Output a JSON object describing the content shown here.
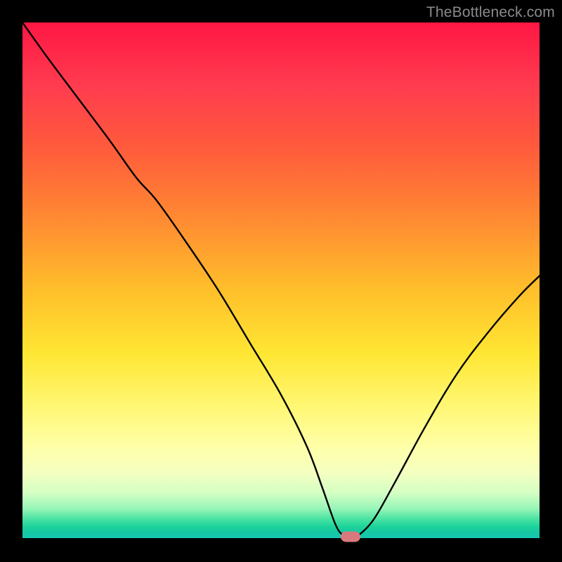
{
  "watermark": "TheBottleneck.com",
  "chart_data": {
    "type": "line",
    "title": "",
    "xlabel": "",
    "ylabel": "",
    "xlim": [
      0,
      100
    ],
    "ylim": [
      0,
      100
    ],
    "gradient_zones": [
      {
        "color": "#ff1744",
        "pct": 0
      },
      {
        "color": "#ff3b4f",
        "pct": 12
      },
      {
        "color": "#ff5a3c",
        "pct": 24
      },
      {
        "color": "#ff8a32",
        "pct": 38
      },
      {
        "color": "#ffc02b",
        "pct": 52
      },
      {
        "color": "#ffe633",
        "pct": 64
      },
      {
        "color": "#fff772",
        "pct": 74
      },
      {
        "color": "#ffffa8",
        "pct": 82
      },
      {
        "color": "#f5ffc0",
        "pct": 87
      },
      {
        "color": "#d4ffc4",
        "pct": 91
      },
      {
        "color": "#98f5b8",
        "pct": 94
      },
      {
        "color": "#4be3a3",
        "pct": 96
      },
      {
        "color": "#1cd39a",
        "pct": 97.5
      },
      {
        "color": "#17c9a2",
        "pct": 98.5
      },
      {
        "color": "#15c6b5",
        "pct": 100
      }
    ],
    "curve": {
      "x": [
        0,
        5,
        11,
        17,
        22,
        26,
        32,
        38,
        44,
        50,
        55,
        58,
        60.5,
        62,
        63.5,
        65,
        68,
        72,
        78,
        84,
        90,
        96,
        100
      ],
      "y": [
        100,
        93,
        85,
        77,
        70,
        65.5,
        57,
        48,
        38,
        28,
        18,
        10,
        3,
        0.8,
        0,
        0.8,
        4,
        11,
        22,
        32,
        40,
        47,
        51
      ]
    },
    "marker": {
      "x": 63.5,
      "y": 0.5,
      "color": "#d87a7d"
    }
  }
}
